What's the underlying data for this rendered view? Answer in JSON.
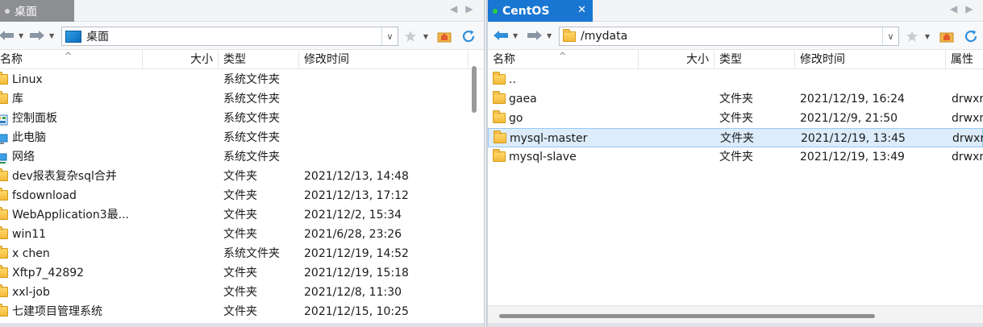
{
  "left": {
    "tab": {
      "title": "桌面"
    },
    "tab_nav": {
      "prev": "◀",
      "next": "▶"
    },
    "address": {
      "value": "桌面"
    },
    "columns": {
      "name": "名称",
      "size": "大小",
      "type": "类型",
      "modified": "修改时间"
    },
    "rows": [
      {
        "name": "Linux",
        "size": "",
        "type": "系统文件夹",
        "modified": "",
        "icon": "folder-icon"
      },
      {
        "name": "库",
        "size": "",
        "type": "系统文件夹",
        "modified": "",
        "icon": "folder-icon"
      },
      {
        "name": "控制面板",
        "size": "",
        "type": "系统文件夹",
        "modified": "",
        "icon": "control-panel-icon"
      },
      {
        "name": "此电脑",
        "size": "",
        "type": "系统文件夹",
        "modified": "",
        "icon": "computer-icon"
      },
      {
        "name": "网络",
        "size": "",
        "type": "系统文件夹",
        "modified": "",
        "icon": "network-icon"
      },
      {
        "name": "dev报表复杂sql合并",
        "size": "",
        "type": "文件夹",
        "modified": "2021/12/13, 14:48",
        "icon": "folder-icon"
      },
      {
        "name": "fsdownload",
        "size": "",
        "type": "文件夹",
        "modified": "2021/12/13, 17:12",
        "icon": "folder-icon"
      },
      {
        "name": "WebApplication3最...",
        "size": "",
        "type": "文件夹",
        "modified": "2021/12/2, 15:34",
        "icon": "folder-icon"
      },
      {
        "name": "win11",
        "size": "",
        "type": "文件夹",
        "modified": "2021/6/28, 23:26",
        "icon": "folder-icon"
      },
      {
        "name": "x chen",
        "size": "",
        "type": "系统文件夹",
        "modified": "2021/12/19, 14:52",
        "icon": "folder-icon"
      },
      {
        "name": "Xftp7_42892",
        "size": "",
        "type": "文件夹",
        "modified": "2021/12/19, 15:18",
        "icon": "folder-icon"
      },
      {
        "name": "xxl-job",
        "size": "",
        "type": "文件夹",
        "modified": "2021/12/8, 11:30",
        "icon": "folder-icon"
      },
      {
        "name": "七建项目管理系统",
        "size": "",
        "type": "文件夹",
        "modified": "2021/12/15, 10:25",
        "icon": "folder-icon"
      }
    ]
  },
  "right": {
    "tab": {
      "title": "CentOS"
    },
    "tab_nav": {
      "prev": "◀",
      "next": "▶"
    },
    "address": {
      "value": "/mydata"
    },
    "columns": {
      "name": "名称",
      "size": "大小",
      "type": "类型",
      "modified": "修改时间",
      "attrs": "属性"
    },
    "rows": [
      {
        "name": "..",
        "size": "",
        "type": "",
        "modified": "",
        "attrs": "",
        "icon": "folder-icon",
        "selected": false
      },
      {
        "name": "gaea",
        "size": "",
        "type": "文件夹",
        "modified": "2021/12/19, 16:24",
        "attrs": "drwxr",
        "icon": "folder-icon",
        "selected": false
      },
      {
        "name": "go",
        "size": "",
        "type": "文件夹",
        "modified": "2021/12/9, 21:50",
        "attrs": "drwxr",
        "icon": "folder-icon",
        "selected": false
      },
      {
        "name": "mysql-master",
        "size": "",
        "type": "文件夹",
        "modified": "2021/12/19, 13:45",
        "attrs": "drwxr",
        "icon": "folder-icon",
        "selected": true
      },
      {
        "name": "mysql-slave",
        "size": "",
        "type": "文件夹",
        "modified": "2021/12/19, 13:49",
        "attrs": "drwxr",
        "icon": "folder-icon",
        "selected": false
      }
    ]
  },
  "colors": {
    "active_tab": "#1976d2",
    "inactive_tab": "#8c8e91",
    "selection": "#dcecfb",
    "folder": "#f4b93a"
  }
}
